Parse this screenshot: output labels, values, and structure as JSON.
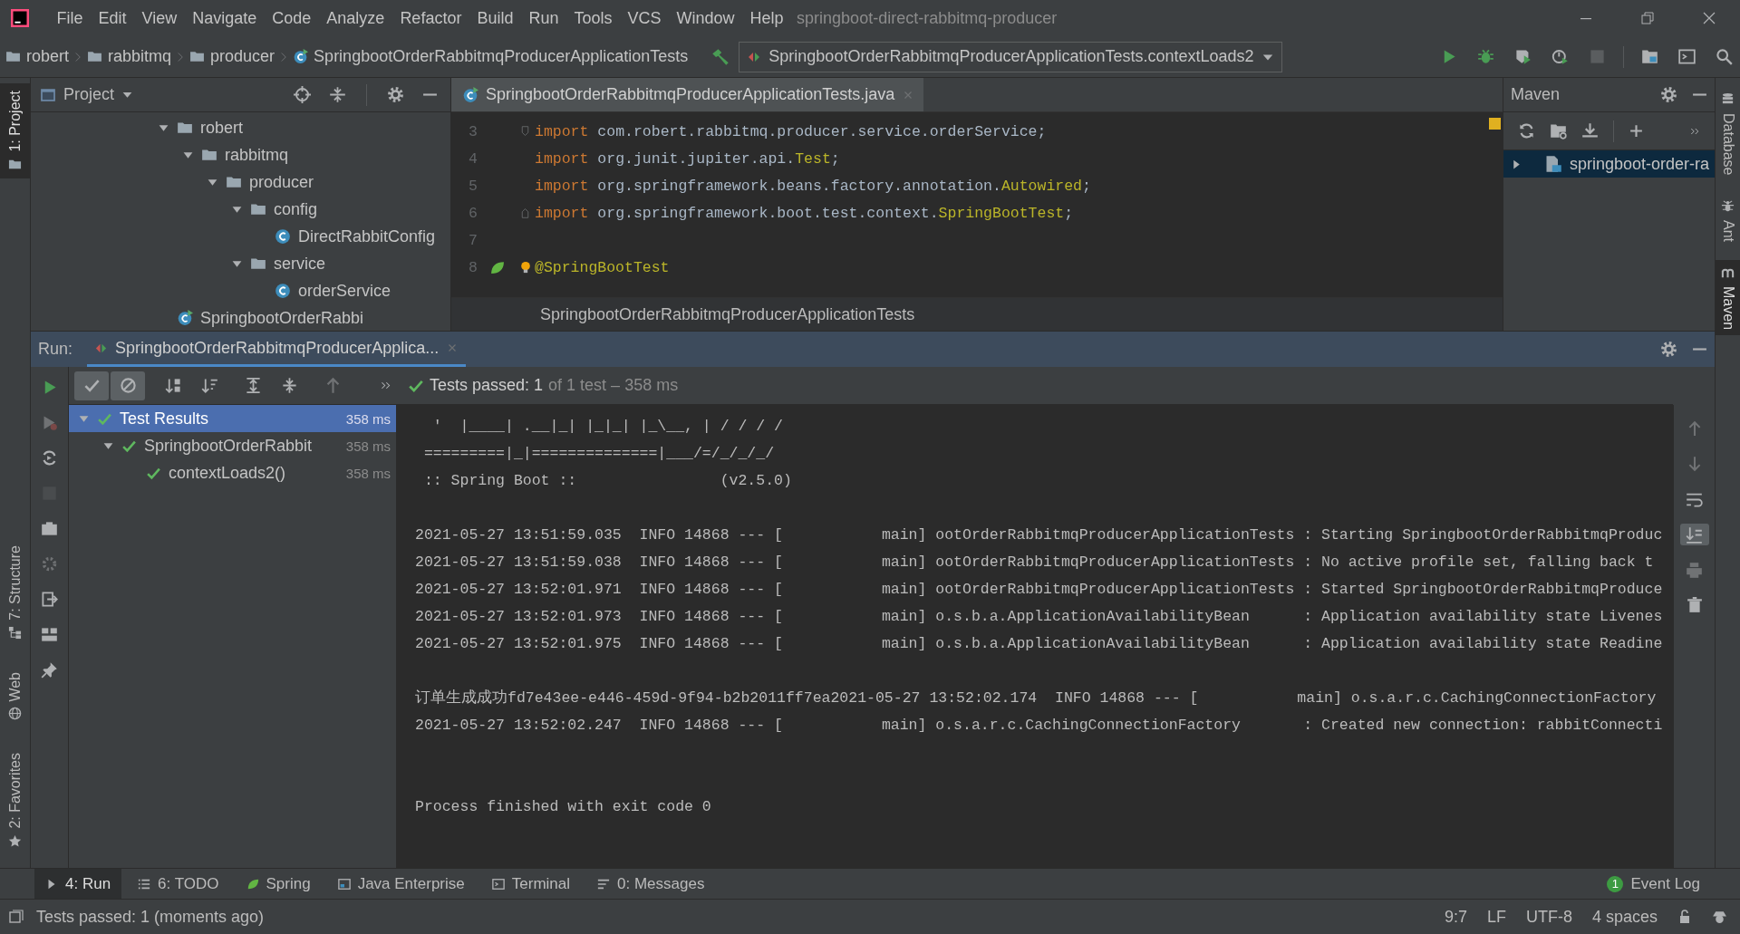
{
  "menu_bar": {
    "items": [
      "File",
      "Edit",
      "View",
      "Navigate",
      "Code",
      "Analyze",
      "Refactor",
      "Build",
      "Run",
      "Tools",
      "VCS",
      "Window",
      "Help"
    ],
    "project_title": "springboot-direct-rabbitmq-producer"
  },
  "navigation_bar": {
    "breadcrumbs": [
      {
        "label": "robert",
        "kind": "folder"
      },
      {
        "label": "rabbitmq",
        "kind": "folder"
      },
      {
        "label": "producer",
        "kind": "folder"
      },
      {
        "label": "SpringbootOrderRabbitmqProducerApplicationTests",
        "kind": "test-class"
      }
    ],
    "run_configuration": "SpringbootOrderRabbitmqProducerApplicationTests.contextLoads2"
  },
  "left_tool_strip": [
    {
      "label": "1: Project",
      "kind": "project",
      "selected": true
    },
    {
      "label": "7: Structure",
      "kind": "structure",
      "selected": false
    },
    {
      "label": "Web",
      "kind": "web",
      "selected": false
    },
    {
      "label": "2: Favorites",
      "kind": "favorites",
      "selected": false
    }
  ],
  "project_panel": {
    "title": "Project",
    "tree": [
      {
        "label": "robert",
        "kind": "folder",
        "expanded": true,
        "children": [
          {
            "label": "rabbitmq",
            "kind": "folder",
            "expanded": true,
            "children": [
              {
                "label": "producer",
                "kind": "folder",
                "expanded": true,
                "children": [
                  {
                    "label": "config",
                    "kind": "folder",
                    "expanded": true,
                    "children": [
                      {
                        "label": "DirectRabbitConfig",
                        "kind": "class"
                      }
                    ]
                  },
                  {
                    "label": "service",
                    "kind": "folder",
                    "expanded": true,
                    "children": [
                      {
                        "label": "orderService",
                        "kind": "class"
                      }
                    ]
                  }
                ]
              }
            ]
          }
        ]
      },
      {
        "label": "SpringbootOrderRabbi",
        "kind": "test-class"
      }
    ]
  },
  "editor": {
    "tabs": [
      {
        "label": "SpringbootOrderRabbitmqProducerApplicationTests.java",
        "selected": true
      }
    ],
    "lines": [
      {
        "number": "3",
        "gutter": {
          "kind": "fold-start"
        },
        "segments": [
          {
            "text": "import",
            "kind": "keyword"
          },
          {
            "text": " com.robert.rabbitmq.producer.service.orderService;",
            "kind": "plain"
          }
        ]
      },
      {
        "number": "4",
        "segments": [
          {
            "text": "import",
            "kind": "keyword"
          },
          {
            "text": " org.junit.jupiter.api.",
            "kind": "plain"
          },
          {
            "text": "Test",
            "kind": "annotation"
          },
          {
            "text": ";",
            "kind": "plain"
          }
        ]
      },
      {
        "number": "5",
        "segments": [
          {
            "text": "import",
            "kind": "keyword"
          },
          {
            "text": " org.springframework.beans.factory.annotation.",
            "kind": "plain"
          },
          {
            "text": "Autowired",
            "kind": "annotation"
          },
          {
            "text": ";",
            "kind": "plain"
          }
        ]
      },
      {
        "number": "6",
        "gutter": {
          "kind": "fold-end"
        },
        "segments": [
          {
            "text": "import",
            "kind": "keyword"
          },
          {
            "text": " org.springframework.boot.test.context.",
            "kind": "plain"
          },
          {
            "text": "SpringBootTest",
            "kind": "annotation"
          },
          {
            "text": ";",
            "kind": "plain"
          }
        ]
      },
      {
        "number": "7"
      },
      {
        "number": "8",
        "gutter": {
          "kind": "spring"
        },
        "intention_bulb": true,
        "segments": [
          {
            "text": "@SpringBootTest",
            "kind": "annotation"
          }
        ]
      }
    ],
    "breadcrumb": "SpringbootOrderRabbitmqProducerApplicationTests"
  },
  "maven_panel": {
    "title": "Maven",
    "projects": [
      {
        "label": "springboot-order-ra",
        "selected": true,
        "expanded": false
      }
    ]
  },
  "right_tool_strip": [
    {
      "label": "Database",
      "kind": "database",
      "selected": false
    },
    {
      "label": "Ant",
      "kind": "ant",
      "selected": false
    },
    {
      "label": "Maven",
      "kind": "maven",
      "selected": true
    }
  ],
  "run_panel": {
    "label": "Run:",
    "tabs": [
      {
        "label": "SpringbootOrderRabbitmqProducerApplica...",
        "selected": true
      }
    ],
    "show_passed": true,
    "show_ignored": true,
    "scroll_to_end": true,
    "summary": "Tests passed: 1",
    "summary_detail": "of 1 test – 358 ms",
    "test_tree": [
      {
        "label": "Test Results",
        "duration": "358 ms",
        "selected": true,
        "expanded": true,
        "children": [
          {
            "label": "SpringbootOrderRabbit",
            "duration": "358 ms",
            "selected": false,
            "expanded": true,
            "children": [
              {
                "label": "contextLoads2()",
                "duration": "358 ms",
                "selected": false
              }
            ]
          }
        ]
      }
    ],
    "console_blocks": [
      {
        "lines": [
          "  '  |____| .__|_| |_|_| |_\\__, | / / / /",
          " =========|_|==============|___/=/_/_/_/",
          " :: Spring Boot ::                (v2.5.0)"
        ]
      },
      {
        "lines": [
          "2021-05-27 13:51:59.035  INFO 14868 --- [           main] ootOrderRabbitmqProducerApplicationTests : Starting SpringbootOrderRabbitmqProduc",
          "2021-05-27 13:51:59.038  INFO 14868 --- [           main] ootOrderRabbitmqProducerApplicationTests : No active profile set, falling back t",
          "2021-05-27 13:52:01.971  INFO 14868 --- [           main] ootOrderRabbitmqProducerApplicationTests : Started SpringbootOrderRabbitmqProduce",
          "2021-05-27 13:52:01.973  INFO 14868 --- [           main] o.s.b.a.ApplicationAvailabilityBean      : Application availability state Livenes",
          "2021-05-27 13:52:01.975  INFO 14868 --- [           main] o.s.b.a.ApplicationAvailabilityBean      : Application availability state Readine"
        ]
      },
      {
        "lines": [
          "订单生成成功fd7e43ee-e446-459d-9f94-b2b2011ff7ea2021-05-27 13:52:02.174  INFO 14868 --- [           main] o.s.a.r.c.CachingConnectionFactory",
          "2021-05-27 13:52:02.247  INFO 14868 --- [           main] o.s.a.r.c.CachingConnectionFactory       : Created new connection: rabbitConnecti"
        ]
      },
      {
        "lines": [
          "Process finished with exit code 0"
        ]
      }
    ]
  },
  "tool_window_tabs": [
    {
      "label": "4: Run",
      "kind": "run",
      "selected": true
    },
    {
      "label": "6: TODO",
      "kind": "todo",
      "selected": false
    },
    {
      "label": "Spring",
      "kind": "spring",
      "selected": false
    },
    {
      "label": "Java Enterprise",
      "kind": "javaee",
      "selected": false
    },
    {
      "label": "Terminal",
      "kind": "terminal",
      "selected": false
    },
    {
      "label": "0: Messages",
      "kind": "messages",
      "selected": false
    }
  ],
  "event_log": {
    "label": "Event Log",
    "count": "1"
  },
  "status_bar": {
    "message": "Tests passed: 1 (moments ago)",
    "position": "9:7",
    "line_separator": "LF",
    "encoding": "UTF-8",
    "indent": "4 spaces"
  }
}
